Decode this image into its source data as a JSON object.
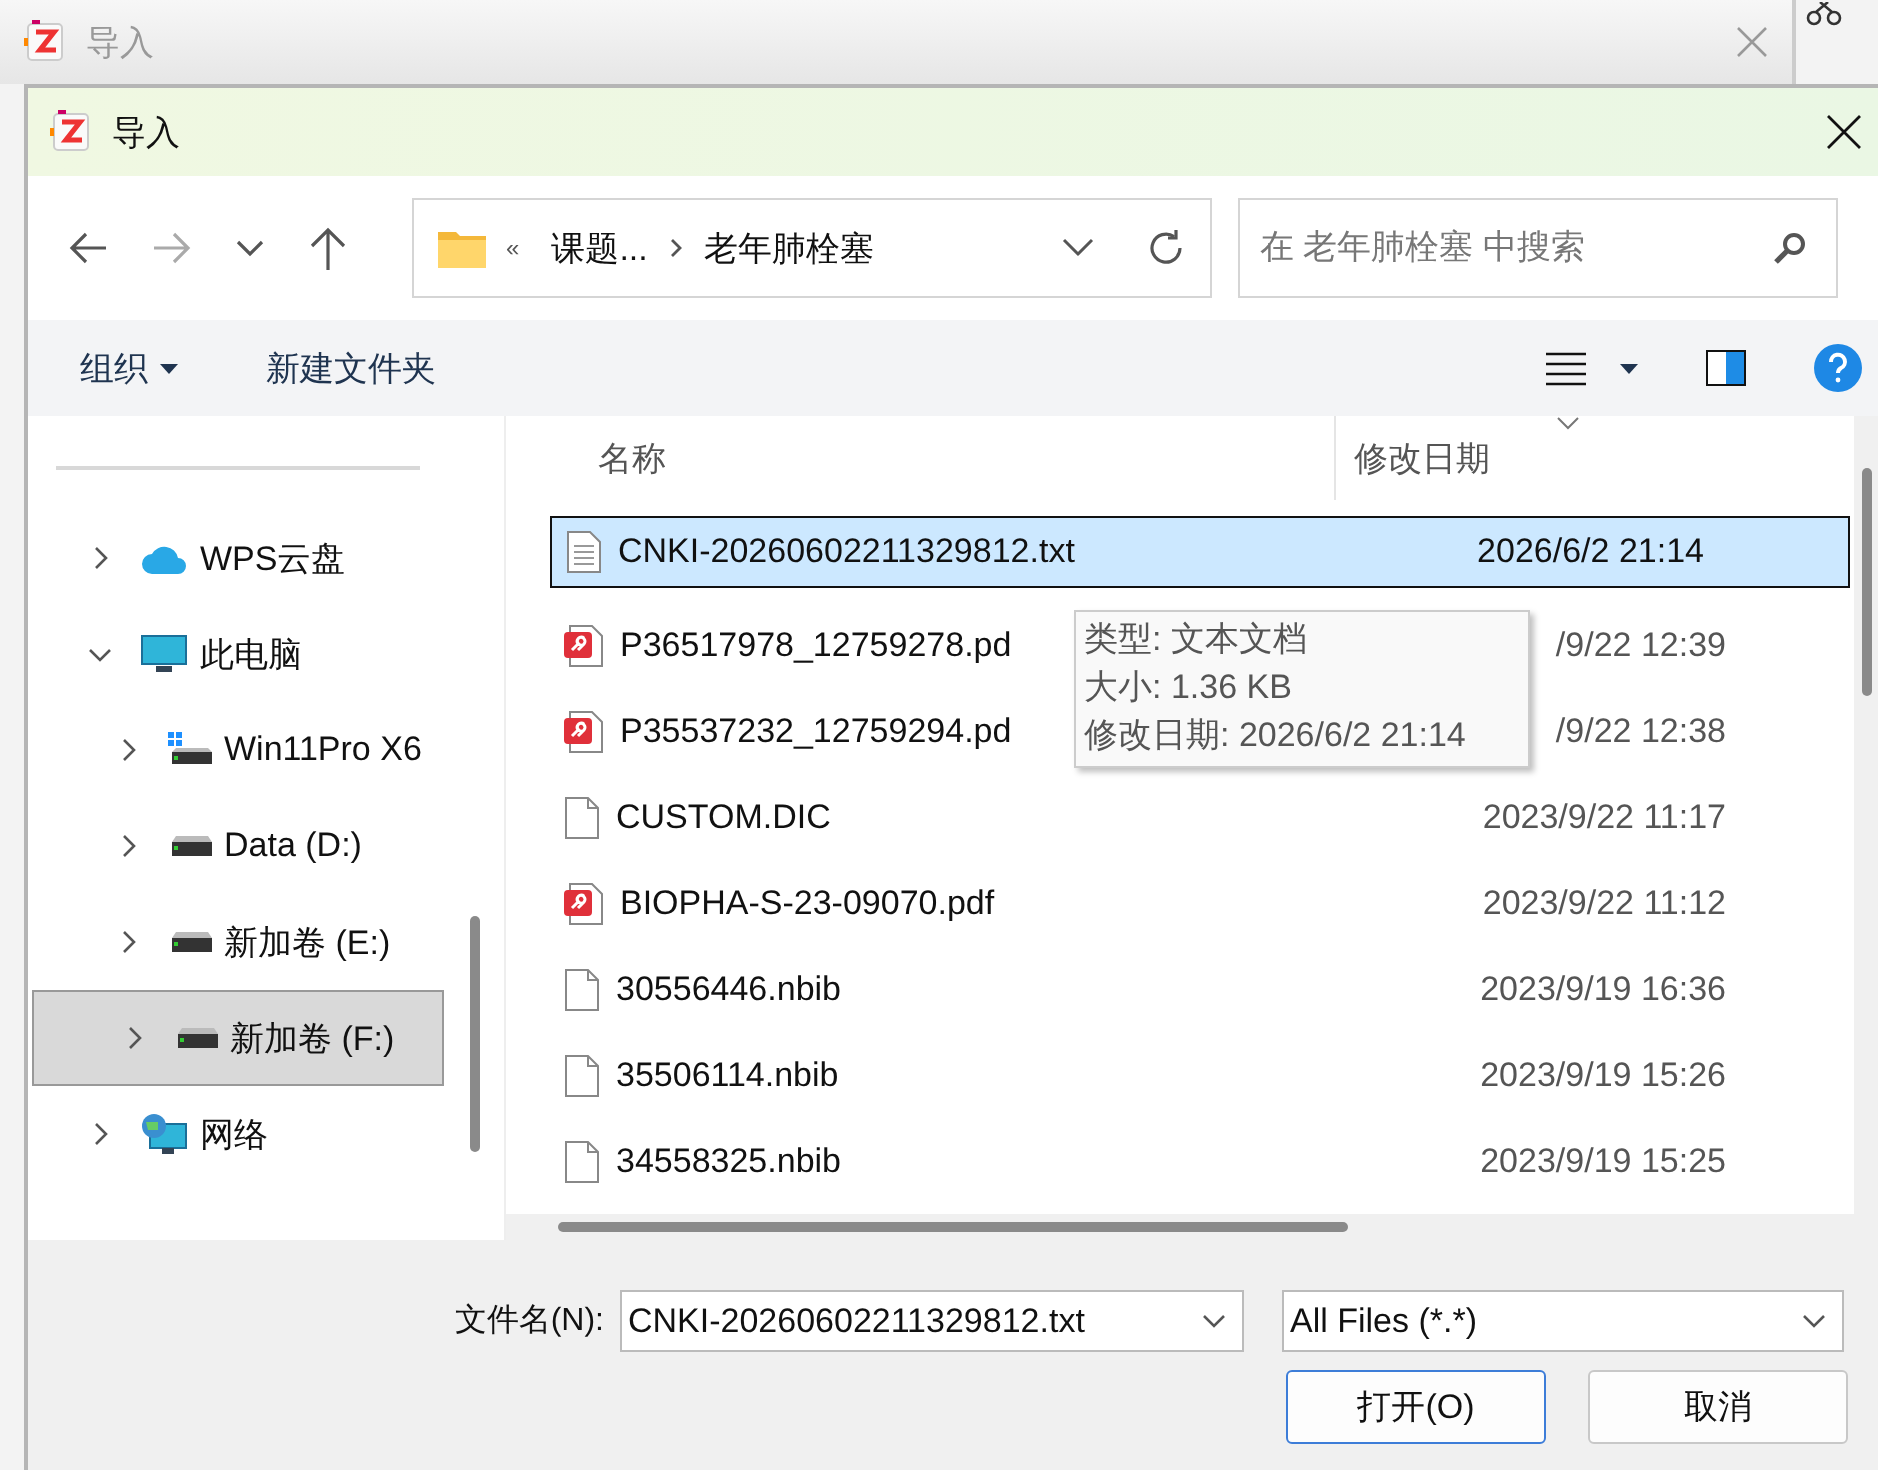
{
  "background_window": {
    "title": "导入"
  },
  "dialog": {
    "title": "导入"
  },
  "address_bar": {
    "overflow": "«",
    "crumbs": [
      "课题...",
      "老年肺栓塞"
    ]
  },
  "search": {
    "placeholder": "在 老年肺栓塞 中搜索"
  },
  "command_bar": {
    "organize": "组织",
    "new_folder": "新建文件夹"
  },
  "nav_pane": {
    "items": [
      {
        "label": "WPS云盘",
        "kind": "cloud",
        "expanded": false,
        "selected": false
      },
      {
        "label": "此电脑",
        "kind": "computer",
        "expanded": true,
        "selected": false,
        "children": [
          {
            "label": "Win11Pro X6",
            "kind": "system_drive",
            "expanded": false,
            "selected": false
          },
          {
            "label": "Data (D:)",
            "kind": "drive",
            "expanded": false,
            "selected": false
          },
          {
            "label": "新加卷 (E:)",
            "kind": "drive",
            "expanded": false,
            "selected": false
          },
          {
            "label": "新加卷 (F:)",
            "kind": "drive",
            "expanded": false,
            "selected": true
          }
        ]
      },
      {
        "label": "网络",
        "kind": "network",
        "expanded": false,
        "selected": false
      }
    ]
  },
  "file_list": {
    "columns": [
      "名称",
      "修改日期"
    ],
    "rows": [
      {
        "name": "CNKI-20260602211329812.txt",
        "date": "2026/6/2 21:14",
        "kind": "text",
        "selected": true
      },
      {
        "name": "P36517978_12759278.pd",
        "date": "/9/22 12:39",
        "kind": "pdf",
        "selected": false
      },
      {
        "name": "P35537232_12759294.pd",
        "date": "/9/22 12:38",
        "kind": "pdf",
        "selected": false
      },
      {
        "name": "CUSTOM.DIC",
        "date": "2023/9/22 11:17",
        "kind": "blank",
        "selected": false
      },
      {
        "name": "BIOPHA-S-23-09070.pdf",
        "date": "2023/9/22 11:12",
        "kind": "pdf",
        "selected": false
      },
      {
        "name": "30556446.nbib",
        "date": "2023/9/19 16:36",
        "kind": "blank",
        "selected": false
      },
      {
        "name": "35506114.nbib",
        "date": "2023/9/19 15:26",
        "kind": "blank",
        "selected": false
      },
      {
        "name": "34558325.nbib",
        "date": "2023/9/19 15:25",
        "kind": "blank",
        "selected": false
      }
    ]
  },
  "tooltip": {
    "lines": [
      "类型: 文本文档",
      "大小: 1.36 KB",
      "修改日期: 2026/6/2 21:14"
    ]
  },
  "footer": {
    "filename_label": "文件名(N):",
    "filename_value": "CNKI-20260602211329812.txt",
    "file_type": "All Files (*.*)",
    "buttons": [
      "打开(O)",
      "取消"
    ]
  }
}
